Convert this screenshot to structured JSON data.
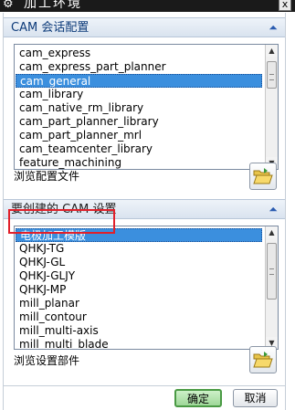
{
  "window": {
    "title": "加工环境",
    "close_glyph": "x"
  },
  "section_config": {
    "label": "CAM 会话配置",
    "items": [
      "cam_express",
      "cam_express_part_planner",
      "cam_general",
      "cam_library",
      "cam_native_rm_library",
      "cam_part_planner_library",
      "cam_part_planner_mrl",
      "cam_teamcenter_library",
      "feature_machining"
    ],
    "selected": "cam_general",
    "browse_label": "浏览配置文件"
  },
  "section_setup": {
    "label": "要创建的 CAM 设置",
    "items": [
      "电极加工模版",
      "QHKJ-TG",
      "QHKJ-GL",
      "QHKJ-GLJY",
      "QHKJ-MP",
      "mill_planar",
      "mill_contour",
      "mill_multi-axis",
      "mill_multi_blade"
    ],
    "selected": "电极加工模版",
    "browse_label": "浏览设置部件"
  },
  "buttons": {
    "ok": "确定",
    "cancel": "取消"
  },
  "icons": {
    "window": "gear-icon",
    "collapse": "chevron-up-icon",
    "browse": "folder-open-icon"
  },
  "colors": {
    "selection": "#3b8fde",
    "section_label": "#0d3b7a",
    "highlight": "#e1202a",
    "ok_border": "#4a9a44"
  }
}
